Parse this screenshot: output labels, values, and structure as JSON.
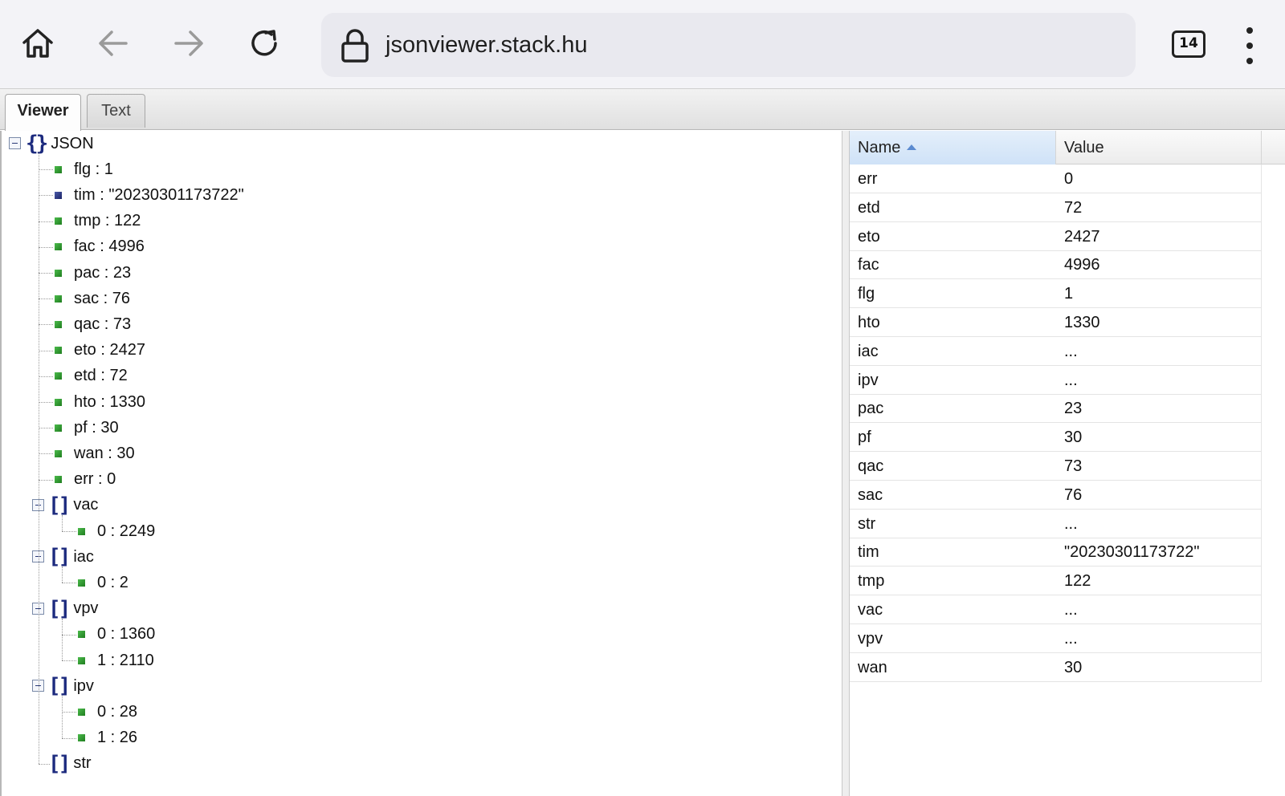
{
  "browser": {
    "url": "jsonviewer.stack.hu",
    "tab_count": "14"
  },
  "tabs": [
    {
      "label": "Viewer",
      "active": true
    },
    {
      "label": "Text",
      "active": false
    }
  ],
  "tree": {
    "root_label": "JSON",
    "items": [
      {
        "text": "flg : 1",
        "type": "number"
      },
      {
        "text": "tim : \"20230301173722\"",
        "type": "string"
      },
      {
        "text": "tmp : 122",
        "type": "number"
      },
      {
        "text": "fac : 4996",
        "type": "number"
      },
      {
        "text": "pac : 23",
        "type": "number"
      },
      {
        "text": "sac : 76",
        "type": "number"
      },
      {
        "text": "qac : 73",
        "type": "number"
      },
      {
        "text": "eto : 2427",
        "type": "number"
      },
      {
        "text": "etd : 72",
        "type": "number"
      },
      {
        "text": "hto : 1330",
        "type": "number"
      },
      {
        "text": "pf : 30",
        "type": "number"
      },
      {
        "text": "wan : 30",
        "type": "number"
      },
      {
        "text": "err : 0",
        "type": "number"
      }
    ],
    "arrays": [
      {
        "name": "vac",
        "children": [
          "0 : 2249"
        ]
      },
      {
        "name": "iac",
        "children": [
          "0 : 2"
        ]
      },
      {
        "name": "vpv",
        "children": [
          "0 : 1360",
          "1 : 2110"
        ]
      },
      {
        "name": "ipv",
        "children": [
          "0 : 28",
          "1 : 26"
        ]
      },
      {
        "name": "str",
        "children": []
      }
    ]
  },
  "grid": {
    "columns": {
      "name": "Name",
      "value": "Value"
    },
    "rows": [
      {
        "name": "err",
        "value": "0"
      },
      {
        "name": "etd",
        "value": "72"
      },
      {
        "name": "eto",
        "value": "2427"
      },
      {
        "name": "fac",
        "value": "4996"
      },
      {
        "name": "flg",
        "value": "1"
      },
      {
        "name": "hto",
        "value": "1330"
      },
      {
        "name": "iac",
        "value": "..."
      },
      {
        "name": "ipv",
        "value": "..."
      },
      {
        "name": "pac",
        "value": "23"
      },
      {
        "name": "pf",
        "value": "30"
      },
      {
        "name": "qac",
        "value": "73"
      },
      {
        "name": "sac",
        "value": "76"
      },
      {
        "name": "str",
        "value": "..."
      },
      {
        "name": "tim",
        "value": "\"20230301173722\""
      },
      {
        "name": "tmp",
        "value": "122"
      },
      {
        "name": "vac",
        "value": "..."
      },
      {
        "name": "vpv",
        "value": "..."
      },
      {
        "name": "wan",
        "value": "30"
      }
    ]
  }
}
